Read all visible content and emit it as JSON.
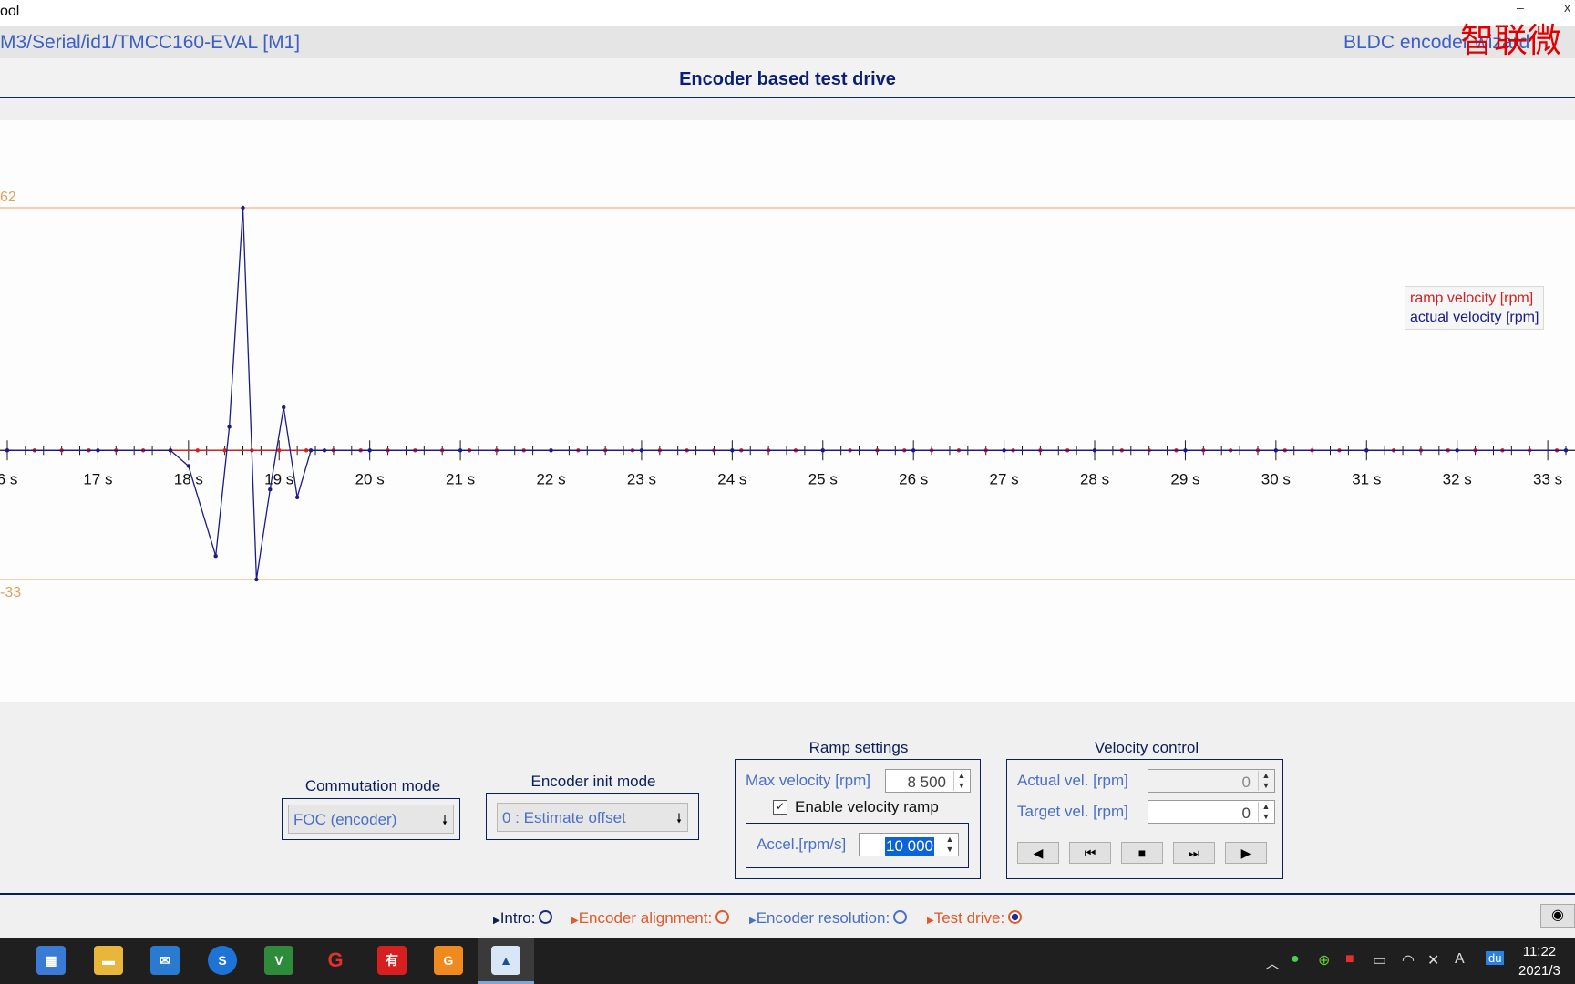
{
  "window": {
    "title": "ool",
    "minimize": "–",
    "close": "x"
  },
  "pathbar": {
    "path": "M3/Serial/id1/TMCC160-EVAL [M1]",
    "wizard": "BLDC encoder wizard",
    "watermark": "智联微"
  },
  "page": {
    "title": "Encoder based test drive"
  },
  "chart_data": {
    "type": "line",
    "ylim": [
      -33,
      62
    ],
    "y_markers": [
      62,
      -33
    ],
    "x_ticks": [
      "6 s",
      "17 s",
      "18 s",
      "19 s",
      "20 s",
      "21 s",
      "22 s",
      "23 s",
      "24 s",
      "25 s",
      "26 s",
      "27 s",
      "28 s",
      "29 s",
      "30 s",
      "31 s",
      "32 s",
      "33 s"
    ],
    "xlim": [
      16,
      33.2
    ],
    "legend_position": "top-right",
    "series": [
      {
        "name": "ramp velocity [rpm]",
        "color": "#d42020",
        "x": [
          16,
          16.3,
          16.6,
          16.9,
          17.2,
          17.5,
          17.8,
          18.1,
          18.4,
          18.7,
          19,
          19.3,
          19.6,
          19.9,
          20.2,
          20.5,
          20.8,
          21.1,
          21.4,
          21.7,
          22,
          22.3,
          22.6,
          22.9,
          23.2,
          23.5,
          23.8,
          24.1,
          24.4,
          24.7,
          25,
          25.3,
          25.6,
          25.9,
          26.2,
          26.5,
          26.8,
          27.1,
          27.4,
          27.7,
          28,
          28.3,
          28.6,
          28.9,
          29.2,
          29.5,
          29.8,
          30.1,
          30.4,
          30.7,
          31,
          31.3,
          31.6,
          31.9,
          32.2,
          32.5,
          32.8,
          33.1
        ],
        "y": [
          0,
          0,
          0,
          0,
          0,
          0,
          0,
          0,
          0,
          0,
          0,
          0,
          0,
          0,
          0,
          0,
          0,
          0,
          0,
          0,
          0,
          0,
          0,
          0,
          0,
          0,
          0,
          0,
          0,
          0,
          0,
          0,
          0,
          0,
          0,
          0,
          0,
          0,
          0,
          0,
          0,
          0,
          0,
          0,
          0,
          0,
          0,
          0,
          0,
          0,
          0,
          0,
          0,
          0,
          0,
          0,
          0,
          0
        ]
      },
      {
        "name": "actual velocity [rpm]",
        "color": "#1a1a8c",
        "x": [
          16,
          17,
          17.8,
          18,
          18.3,
          18.45,
          18.6,
          18.75,
          18.9,
          19.05,
          19.2,
          19.35,
          19.5,
          20,
          21,
          22,
          23,
          24,
          25,
          26,
          27,
          28,
          29,
          30,
          31,
          32,
          33.2
        ],
        "y": [
          0,
          0,
          0,
          -4,
          -27,
          6,
          62,
          -33,
          -10,
          11,
          -12,
          0,
          0,
          0,
          0,
          0,
          0,
          0,
          0,
          0,
          0,
          0,
          0,
          0,
          0,
          0,
          0
        ]
      }
    ]
  },
  "controls": {
    "commutation": {
      "title": "Commutation mode",
      "value": "FOC (encoder)"
    },
    "encoder_init": {
      "title": "Encoder init mode",
      "value": "0 : Estimate offset"
    },
    "ramp": {
      "title": "Ramp settings",
      "max_velocity_label": "Max velocity [rpm]",
      "max_velocity_value": "8 500",
      "enable_ramp_label": "Enable velocity ramp",
      "enable_ramp_checked": true,
      "accel_label": "Accel.[rpm/s]",
      "accel_value": "10 000"
    },
    "velocity": {
      "title": "Velocity control",
      "actual_label": "Actual vel. [rpm]",
      "actual_value": "0",
      "target_label": "Target vel. [rpm]",
      "target_value": "0"
    }
  },
  "nav": {
    "intro": "Intro:",
    "alignment": "Encoder alignment:",
    "resolution": "Encoder resolution:",
    "test_drive": "Test drive:",
    "active": "test_drive"
  },
  "taskbar": {
    "time": "11:22",
    "date": "2021/3"
  }
}
